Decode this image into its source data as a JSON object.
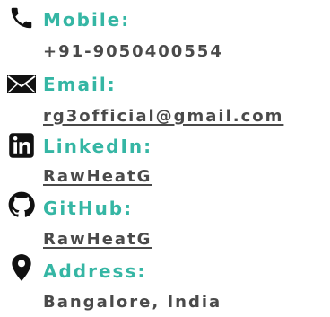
{
  "colors": {
    "label": "#35b6a4",
    "value": "#4a4a4a",
    "icon": "#111111"
  },
  "contact": [
    {
      "icon": "phone-icon",
      "label": "Mobile:",
      "value": "+91-9050400554",
      "link": false
    },
    {
      "icon": "email-icon",
      "label": "Email:",
      "value": "rg3official@gmail.com",
      "link": true
    },
    {
      "icon": "linkedin-icon",
      "label": "LinkedIn:",
      "value": "RawHeatG",
      "link": true
    },
    {
      "icon": "github-icon",
      "label": "GitHub:",
      "value": "RawHeatG",
      "link": true
    },
    {
      "icon": "location-pin-icon",
      "label": "Address:",
      "value": "Bangalore, India",
      "link": false
    }
  ]
}
